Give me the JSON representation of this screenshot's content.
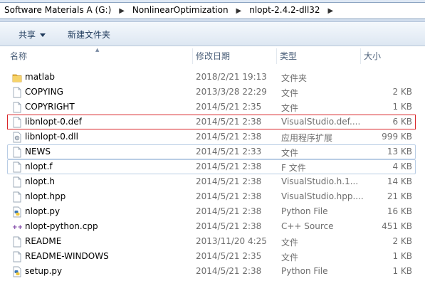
{
  "address": {
    "crumbs": [
      "Software  Materials A (G:)",
      "NonlinearOptimization",
      "nlopt-2.4.2-dll32"
    ]
  },
  "toolbar": {
    "share_label": "共享",
    "new_folder_label": "新建文件夹"
  },
  "columns": {
    "name": "名称",
    "date": "修改日期",
    "type": "类型",
    "size": "大小"
  },
  "files": [
    {
      "name": "matlab",
      "date": "2018/2/21 19:13",
      "type": "文件夹",
      "size": "",
      "icon": "folder-icon"
    },
    {
      "name": "COPYING",
      "date": "2013/3/28 22:29",
      "type": "文件",
      "size": "2 KB",
      "icon": "file-icon"
    },
    {
      "name": "COPYRIGHT",
      "date": "2014/5/21 2:35",
      "type": "文件",
      "size": "1 KB",
      "icon": "file-icon"
    },
    {
      "name": "libnlopt-0.def",
      "date": "2014/5/21 2:38",
      "type": "VisualStudio.def....",
      "size": "6 KB",
      "icon": "file-icon"
    },
    {
      "name": "libnlopt-0.dll",
      "date": "2014/5/21 2:38",
      "type": "应用程序扩展",
      "size": "999 KB",
      "icon": "dll-icon"
    },
    {
      "name": "NEWS",
      "date": "2014/5/21 2:33",
      "type": "文件",
      "size": "13 KB",
      "icon": "file-icon"
    },
    {
      "name": "nlopt.f",
      "date": "2014/5/21 2:38",
      "type": "F 文件",
      "size": "4 KB",
      "icon": "file-icon"
    },
    {
      "name": "nlopt.h",
      "date": "2014/5/21 2:38",
      "type": "VisualStudio.h.1...",
      "size": "14 KB",
      "icon": "file-icon"
    },
    {
      "name": "nlopt.hpp",
      "date": "2014/5/21 2:38",
      "type": "VisualStudio.hpp....",
      "size": "21 KB",
      "icon": "file-icon"
    },
    {
      "name": "nlopt.py",
      "date": "2014/5/21 2:38",
      "type": "Python File",
      "size": "16 KB",
      "icon": "python-icon"
    },
    {
      "name": "nlopt-python.cpp",
      "date": "2014/5/21 2:38",
      "type": "C++ Source",
      "size": "451 KB",
      "icon": "cpp-icon"
    },
    {
      "name": "README",
      "date": "2013/11/20 4:25",
      "type": "文件",
      "size": "2 KB",
      "icon": "file-icon"
    },
    {
      "name": "README-WINDOWS",
      "date": "2014/5/21 2:35",
      "type": "文件",
      "size": "1 KB",
      "icon": "file-icon"
    },
    {
      "name": "setup.py",
      "date": "2014/5/21 2:38",
      "type": "Python File",
      "size": "1 KB",
      "icon": "python-icon"
    }
  ],
  "colors": {
    "selection_red": "#d9262a",
    "hover_blue": "#b9cde5",
    "folder_yellow": "#f2c94c"
  }
}
